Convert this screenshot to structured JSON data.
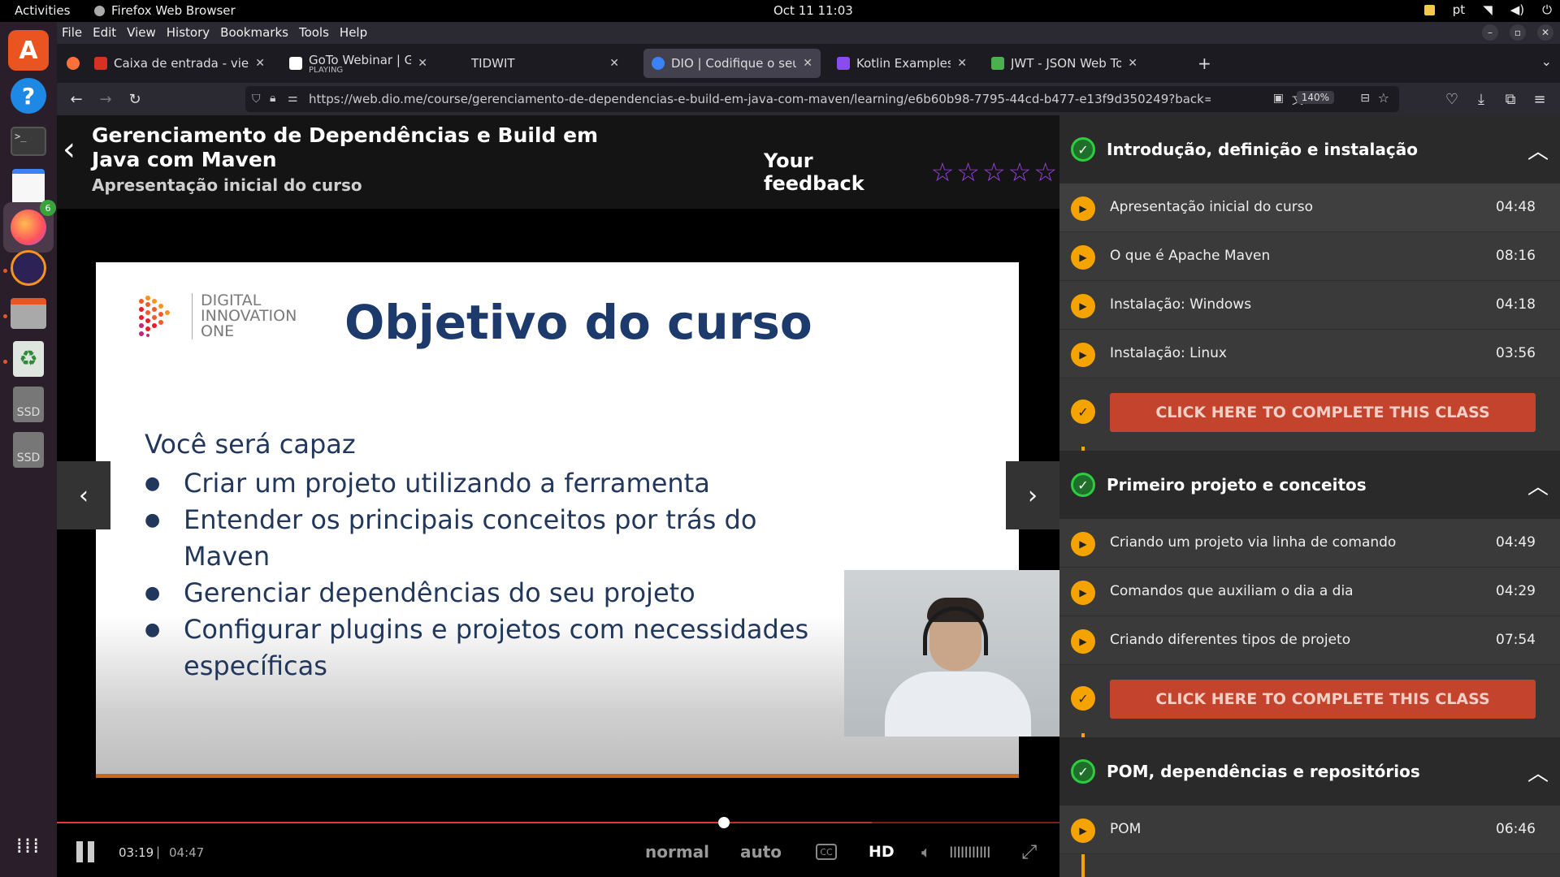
{
  "system": {
    "activities": "Activities",
    "app_name": "Firefox Web Browser",
    "clock": "Oct 11  11:03",
    "lang": "pt"
  },
  "dock": {
    "firefox_badge": "6",
    "ssd1": "SSD",
    "ssd2": "SSD"
  },
  "menubar": {
    "items": [
      "File",
      "Edit",
      "View",
      "History",
      "Bookmarks",
      "Tools",
      "Help"
    ]
  },
  "tabs": [
    {
      "label": "Caixa de entrada - vieira.f",
      "fav_color": "#d93025"
    },
    {
      "label": "GoTo Webinar | GoTo We",
      "sub": "PLAYING",
      "fav_color": "#ffffff"
    },
    {
      "label": "TIDWIT",
      "fav_color": ""
    },
    {
      "label": "DIO | Codifique o seu futu",
      "fav_color": "#3b82f6"
    },
    {
      "label": "Kotlin Examples: Learn Ko",
      "fav_color": "#8a4cf0"
    },
    {
      "label": "JWT - JSON Web Token - ",
      "fav_color": "#4caf50"
    }
  ],
  "navbar": {
    "url": "https://web.dio.me/course/gerenciamento-de-dependencias-e-build-em-java-com-maven/learning/e6b60b98-7795-44cd-b477-e13f9d350249?back=/track/coo",
    "zoom": "140%"
  },
  "header": {
    "course_title": "Gerenciamento de Dependências e Build em Java com Maven",
    "lesson_subtitle": "Apresentação inicial do curso",
    "feedback_label": "Your feedback",
    "star_count": 5
  },
  "slide": {
    "logo_line1": "DIGITAL",
    "logo_line2": "INNOVATION",
    "logo_line3": "ONE",
    "title": "Objetivo do curso",
    "intro": "Você será capaz",
    "bullets": [
      "Criar um projeto utilizando a ferramenta",
      "Entender os principais conceitos por trás do Maven",
      "Gerenciar dependências do seu projeto",
      "Configurar plugins e projetos com necessidades específicas"
    ]
  },
  "player": {
    "current_time": "03:19",
    "separator": "|",
    "duration": "04:47",
    "progress_fraction": 0.665,
    "buffer_fraction": 0.813,
    "speed": "normal",
    "quality": "auto",
    "cc": "CC",
    "hd": "HD",
    "volume_bars": "IIIIIIIIIII"
  },
  "sidebar": {
    "modules": [
      {
        "title": "Introdução, definição e instalação",
        "lessons": [
          {
            "title": "Apresentação inicial do curso",
            "duration": "04:48"
          },
          {
            "title": "O que é Apache Maven",
            "duration": "08:16"
          },
          {
            "title": "Instalação: Windows",
            "duration": "04:18"
          },
          {
            "title": "Instalação: Linux",
            "duration": "03:56"
          }
        ],
        "complete_label": "CLICK HERE TO COMPLETE THIS CLASS"
      },
      {
        "title": "Primeiro projeto e conceitos",
        "lessons": [
          {
            "title": "Criando um projeto via linha de comando",
            "duration": "04:49"
          },
          {
            "title": "Comandos que auxiliam o dia a dia",
            "duration": "04:29"
          },
          {
            "title": "Criando diferentes tipos de projeto",
            "duration": "07:54"
          }
        ],
        "complete_label": "CLICK HERE TO COMPLETE THIS CLASS"
      },
      {
        "title": "POM, dependências e repositórios",
        "lessons": [
          {
            "title": "POM",
            "duration": "06:46"
          }
        ]
      }
    ]
  },
  "colors": {
    "accent_orange": "#f5a300",
    "complete_red": "#c4432c",
    "star_purple": "#9b45e0",
    "check_green": "#2ecc40"
  }
}
